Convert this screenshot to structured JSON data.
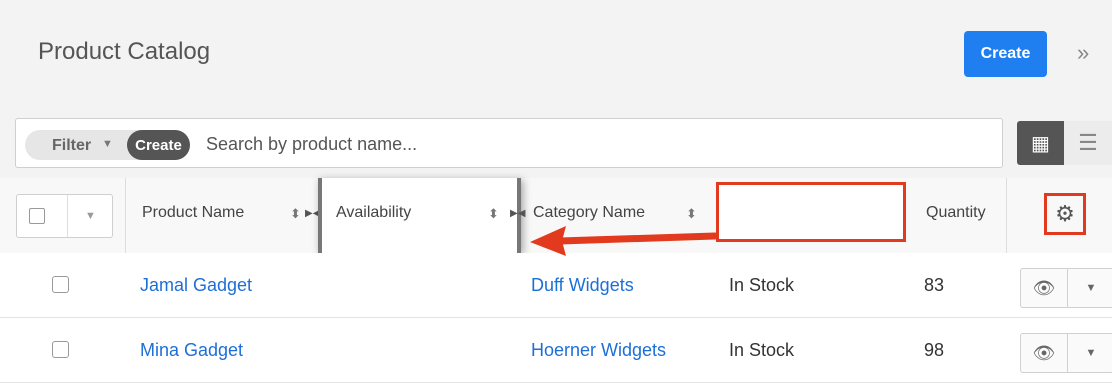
{
  "header": {
    "title": "Product Catalog",
    "create_label": "Create",
    "collapse_icon": "double-chevron-right-icon"
  },
  "filterbar": {
    "filter_label": "Filter",
    "filter_create_label": "Create",
    "search_placeholder": "Search by product name...",
    "view_toggle": [
      "grid-view-icon",
      "list-view-icon"
    ]
  },
  "table": {
    "columns": [
      "Product Name",
      "Availability",
      "Category Name",
      "Quantity"
    ],
    "rows": [
      {
        "product_name": "Jamal Gadget",
        "category_name": "Duff Widgets",
        "availability": "In Stock",
        "quantity": "83"
      },
      {
        "product_name": "Mina Gadget",
        "category_name": "Hoerner Widgets",
        "availability": "In Stock",
        "quantity": "98"
      }
    ]
  },
  "colors": {
    "accent": "#1f7ff0",
    "annotation": "#e23a1e",
    "link": "#1d6fd8"
  }
}
